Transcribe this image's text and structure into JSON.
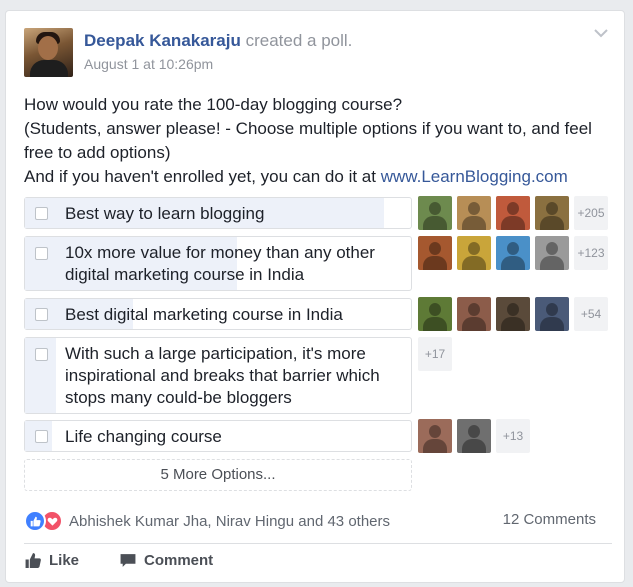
{
  "post": {
    "author": "Deepak Kanakaraju",
    "action": "created a poll.",
    "timestamp": "August 1 at 10:26pm",
    "lines": [
      "How would you rate the 100-day blogging course?",
      "(Students, answer please! - Choose multiple options if you want to, and feel free to add options)"
    ],
    "enroll_prefix": "And if you haven't enrolled yet, you can do it at ",
    "enroll_link": "www.LearnBlogging.com"
  },
  "poll": {
    "options": [
      {
        "label": "Best way to learn blogging",
        "more": "+205",
        "fill_fraction": 0.93
      },
      {
        "label": "10x more value for money than any other digital marketing course in India",
        "more": "+123",
        "fill_fraction": 0.55
      },
      {
        "label": "Best digital marketing course in India",
        "more": "+54",
        "fill_fraction": 0.28
      },
      {
        "label": "With such a large participation, it's more inspirational and breaks that barrier which stops many could-be bloggers",
        "more": "+17",
        "fill_fraction": 0.08
      },
      {
        "label": "Life changing course",
        "more": "+13",
        "fill_fraction": 0.07
      }
    ],
    "more_options": "5 More Options..."
  },
  "footer": {
    "reactors": "Abhishek Kumar Jha, Nirav Hingu and 43 others",
    "comments": "12 Comments",
    "like": "Like",
    "comment": "Comment"
  },
  "colors": {
    "link": "#365899",
    "vote_fill": "#edf1f9",
    "like_reaction": "#4080ff",
    "love_reaction": "#f25268"
  }
}
